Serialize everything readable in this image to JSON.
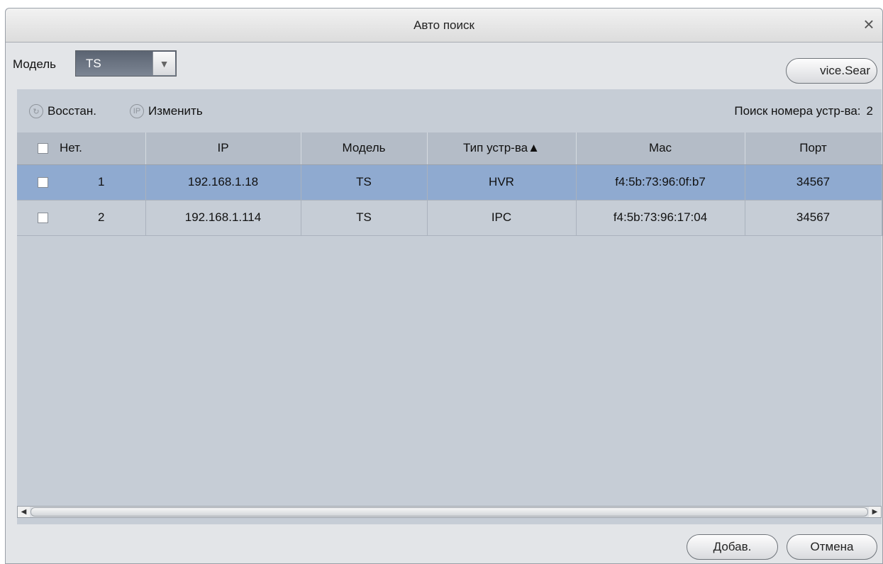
{
  "dialog": {
    "title": "Авто поиск",
    "close_icon": "×"
  },
  "filter": {
    "model_label": "Модель",
    "model_value": "TS",
    "dropdown_arrow": "▼",
    "search_button": "vice.Sear"
  },
  "toolbar": {
    "restore_label": "Восстан.",
    "restore_icon": "↻",
    "modify_label": "Изменить",
    "modify_icon": "IP",
    "count_label": "Поиск номера устр-ва:",
    "count_value": "2"
  },
  "table": {
    "headers": {
      "num": "Нет.",
      "ip": "IP",
      "model": "Модель",
      "type": "Тип устр-ва▲",
      "mac": "Mac",
      "port": "Порт"
    },
    "rows": [
      {
        "num": "1",
        "ip": "192.168.1.18",
        "model": "TS",
        "type": "HVR",
        "mac": "f4:5b:73:96:0f:b7",
        "port": "34567"
      },
      {
        "num": "2",
        "ip": "192.168.1.114",
        "model": "TS",
        "type": "IPC",
        "mac": "f4:5b:73:96:17:04",
        "port": "34567"
      }
    ]
  },
  "scroll": {
    "left_arrow": "◀",
    "right_arrow": "▶"
  },
  "footer": {
    "add_button": "Добав.",
    "cancel_button": "Отмена"
  },
  "colors": {
    "selected_row": "#8faad0",
    "panel": "#c6cdd6",
    "header": "#b4bcc7"
  }
}
